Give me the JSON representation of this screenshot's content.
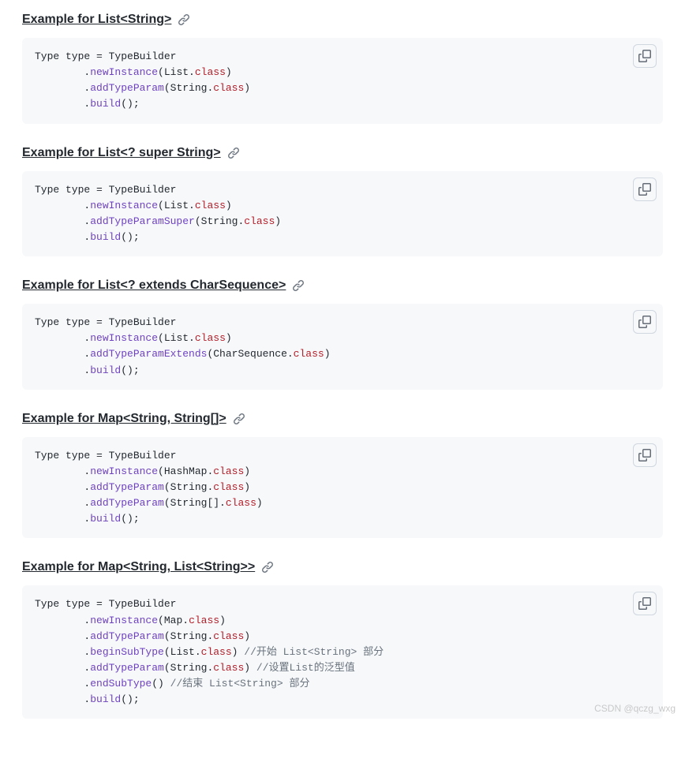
{
  "watermark": "CSDN @qczg_wxg",
  "sections": [
    {
      "heading": "Example for List<String>",
      "code_tokens": [
        {
          "t": "Type type = TypeBuilder\n"
        },
        {
          "t": "        ."
        },
        {
          "t": "newInstance",
          "c": "tok-method"
        },
        {
          "t": "(List."
        },
        {
          "t": "class",
          "c": "tok-class"
        },
        {
          "t": ")\n"
        },
        {
          "t": "        ."
        },
        {
          "t": "addTypeParam",
          "c": "tok-method"
        },
        {
          "t": "(String."
        },
        {
          "t": "class",
          "c": "tok-class"
        },
        {
          "t": ")\n"
        },
        {
          "t": "        ."
        },
        {
          "t": "build",
          "c": "tok-method"
        },
        {
          "t": "();"
        }
      ]
    },
    {
      "heading": "Example for List<? super String>",
      "code_tokens": [
        {
          "t": "Type type = TypeBuilder\n"
        },
        {
          "t": "        ."
        },
        {
          "t": "newInstance",
          "c": "tok-method"
        },
        {
          "t": "(List."
        },
        {
          "t": "class",
          "c": "tok-class"
        },
        {
          "t": ")\n"
        },
        {
          "t": "        ."
        },
        {
          "t": "addTypeParamSuper",
          "c": "tok-method"
        },
        {
          "t": "(String."
        },
        {
          "t": "class",
          "c": "tok-class"
        },
        {
          "t": ")\n"
        },
        {
          "t": "        ."
        },
        {
          "t": "build",
          "c": "tok-method"
        },
        {
          "t": "();"
        }
      ]
    },
    {
      "heading": "Example for List<? extends CharSequence>",
      "code_tokens": [
        {
          "t": "Type type = TypeBuilder\n"
        },
        {
          "t": "        ."
        },
        {
          "t": "newInstance",
          "c": "tok-method"
        },
        {
          "t": "(List."
        },
        {
          "t": "class",
          "c": "tok-class"
        },
        {
          "t": ")\n"
        },
        {
          "t": "        ."
        },
        {
          "t": "addTypeParamExtends",
          "c": "tok-method"
        },
        {
          "t": "(CharSequence."
        },
        {
          "t": "class",
          "c": "tok-class"
        },
        {
          "t": ")\n"
        },
        {
          "t": "        ."
        },
        {
          "t": "build",
          "c": "tok-method"
        },
        {
          "t": "();"
        }
      ]
    },
    {
      "heading": "Example for Map<String, String[]>",
      "code_tokens": [
        {
          "t": "Type type = TypeBuilder\n"
        },
        {
          "t": "        ."
        },
        {
          "t": "newInstance",
          "c": "tok-method"
        },
        {
          "t": "(HashMap."
        },
        {
          "t": "class",
          "c": "tok-class"
        },
        {
          "t": ")\n"
        },
        {
          "t": "        ."
        },
        {
          "t": "addTypeParam",
          "c": "tok-method"
        },
        {
          "t": "(String."
        },
        {
          "t": "class",
          "c": "tok-class"
        },
        {
          "t": ")\n"
        },
        {
          "t": "        ."
        },
        {
          "t": "addTypeParam",
          "c": "tok-method"
        },
        {
          "t": "(String[]."
        },
        {
          "t": "class",
          "c": "tok-class"
        },
        {
          "t": ")\n"
        },
        {
          "t": "        ."
        },
        {
          "t": "build",
          "c": "tok-method"
        },
        {
          "t": "();"
        }
      ]
    },
    {
      "heading": "Example for Map<String, List<String>>",
      "code_tokens": [
        {
          "t": "Type type = TypeBuilder\n"
        },
        {
          "t": "        ."
        },
        {
          "t": "newInstance",
          "c": "tok-method"
        },
        {
          "t": "(Map."
        },
        {
          "t": "class",
          "c": "tok-class"
        },
        {
          "t": ")\n"
        },
        {
          "t": "        ."
        },
        {
          "t": "addTypeParam",
          "c": "tok-method"
        },
        {
          "t": "(String."
        },
        {
          "t": "class",
          "c": "tok-class"
        },
        {
          "t": ")\n"
        },
        {
          "t": "        ."
        },
        {
          "t": "beginSubType",
          "c": "tok-method"
        },
        {
          "t": "(List."
        },
        {
          "t": "class",
          "c": "tok-class"
        },
        {
          "t": ") "
        },
        {
          "t": "//开始 List<String> 部分",
          "c": "tok-comment"
        },
        {
          "t": "\n"
        },
        {
          "t": "        ."
        },
        {
          "t": "addTypeParam",
          "c": "tok-method"
        },
        {
          "t": "(String."
        },
        {
          "t": "class",
          "c": "tok-class"
        },
        {
          "t": ") "
        },
        {
          "t": "//设置List的泛型值",
          "c": "tok-comment"
        },
        {
          "t": "\n"
        },
        {
          "t": "        ."
        },
        {
          "t": "endSubType",
          "c": "tok-method"
        },
        {
          "t": "() "
        },
        {
          "t": "//结束 List<String> 部分",
          "c": "tok-comment"
        },
        {
          "t": "\n"
        },
        {
          "t": "        ."
        },
        {
          "t": "build",
          "c": "tok-method"
        },
        {
          "t": "();"
        }
      ]
    }
  ]
}
